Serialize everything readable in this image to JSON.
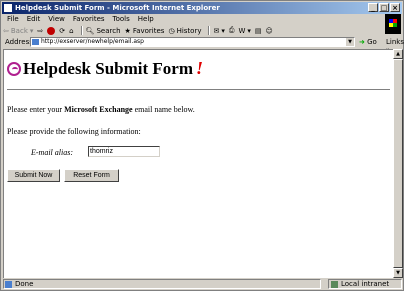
{
  "window": {
    "title": "Helpdesk Submit Form - Microsoft Internet Explorer",
    "minimize": "_",
    "maximize": "□",
    "close": "×"
  },
  "menu": [
    "File",
    "Edit",
    "View",
    "Favorites",
    "Tools",
    "Help"
  ],
  "toolbar": {
    "back": "Back",
    "search": "Search",
    "favorites": "Favorites",
    "history": "History",
    "go": "Go",
    "links": "Links"
  },
  "address": {
    "label": "Address",
    "url": "http://exserver/newhelp/email.asp"
  },
  "page": {
    "heading": "Helpdesk Submit Form",
    "heading_mark": "!",
    "para1_before": "Please enter your ",
    "para1_bold": "Microsoft Exchange",
    "para1_after": " email name below.",
    "para2": "Please provide the following information:",
    "field_label": "E-mail alias:",
    "field_value": "thomriz",
    "submit_label": "Submit Now",
    "reset_label": "Reset Form"
  },
  "status": {
    "left": "Done",
    "zone": "Local intranet"
  },
  "colors": {
    "title_gradient_start": "#0a246a",
    "title_gradient_end": "#a6caf0",
    "heading_mark": "#e00000",
    "logo": "#b0208f"
  }
}
